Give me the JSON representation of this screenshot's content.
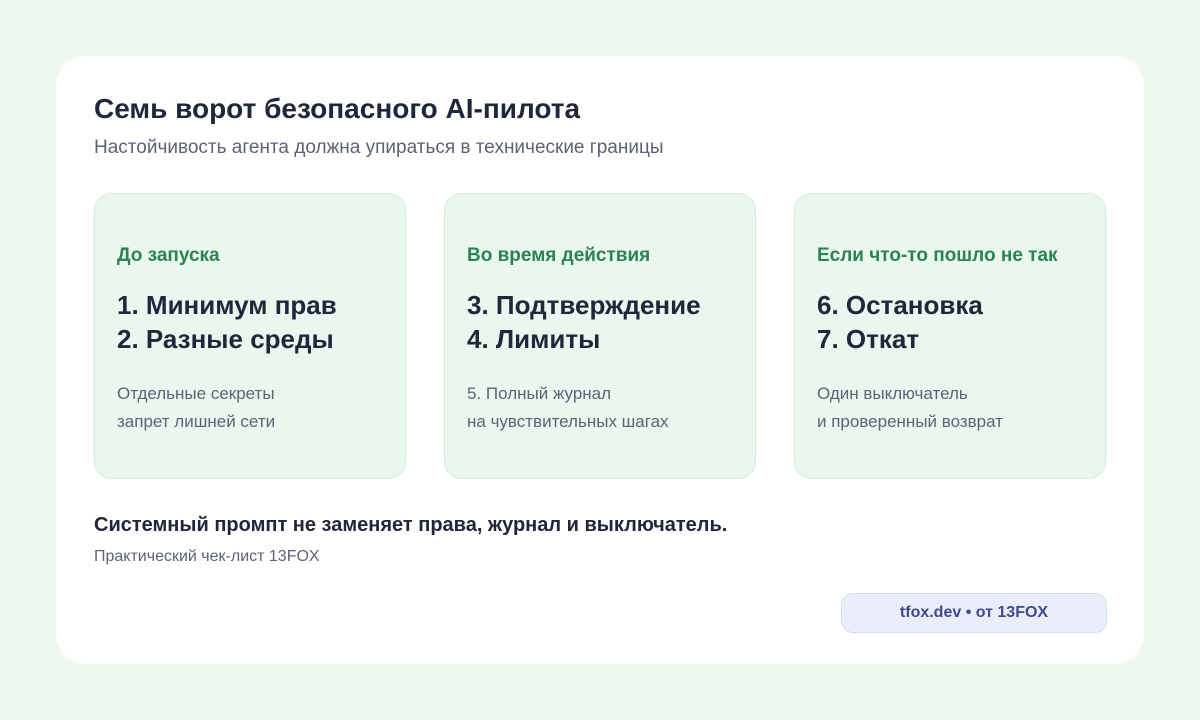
{
  "header": {
    "title": "Семь ворот безопасного AI-пилота",
    "subtitle": "Настойчивость агента должна упираться в технические границы"
  },
  "columns": [
    {
      "heading": "До запуска",
      "items": [
        "1. Минимум прав",
        "2. Разные среды"
      ],
      "notes": [
        "Отдельные секреты",
        "запрет лишней сети"
      ]
    },
    {
      "heading": "Во время действия",
      "items": [
        "3. Подтверждение",
        "4. Лимиты"
      ],
      "notes": [
        "5. Полный журнал",
        "на чувствительных шагах"
      ]
    },
    {
      "heading": "Если что-то пошло не так",
      "items": [
        "6. Остановка",
        "7. Откат"
      ],
      "notes": [
        "Один выключатель",
        "и проверенный возврат"
      ]
    }
  ],
  "footer": {
    "summary": "Системный промпт не заменяет права, журнал и выключатель.",
    "caption": "Практический чек-лист 13FOX",
    "badge": "tfox.dev • от 13FOX"
  },
  "colors": {
    "page_background": "#eef7f0",
    "card_background": "#ffffff",
    "column_background": "#e9f7ee",
    "heading_green": "#2c8352",
    "text_dark": "#22263a",
    "text_muted": "#5d6274",
    "badge_background": "#eaeefb",
    "badge_text": "#3e4a8a"
  }
}
